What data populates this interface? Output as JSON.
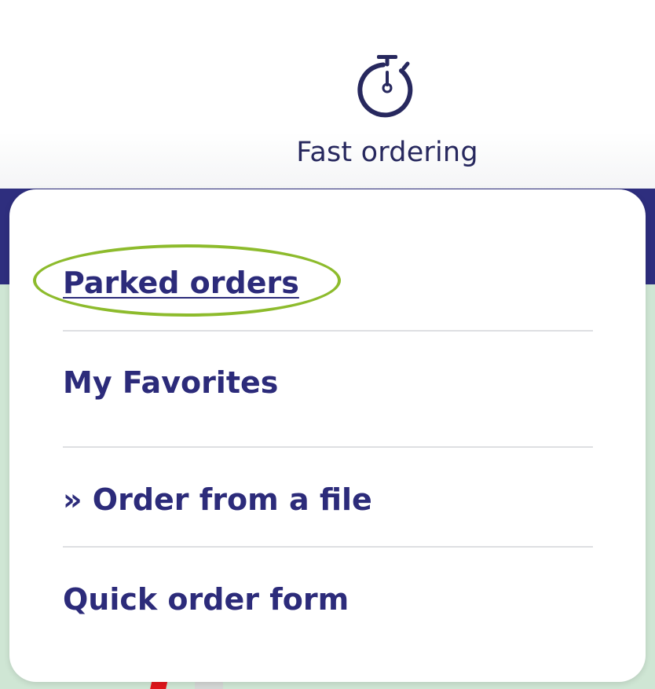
{
  "header": {
    "fast_ordering": {
      "label": "Fast ordering",
      "icon": "stopwatch-icon"
    }
  },
  "dropdown": {
    "items": [
      {
        "label": "Parked orders"
      },
      {
        "label": "My Favorites"
      },
      {
        "label": "» Order from a file"
      },
      {
        "label": "Quick order form"
      }
    ]
  },
  "colors": {
    "brand_navy": "#2e2e7e",
    "menu_text": "#2c2b7a",
    "highlight": "#8dbb2c",
    "content_bg": "#cfe6d4",
    "accent_red": "#e0161b"
  }
}
